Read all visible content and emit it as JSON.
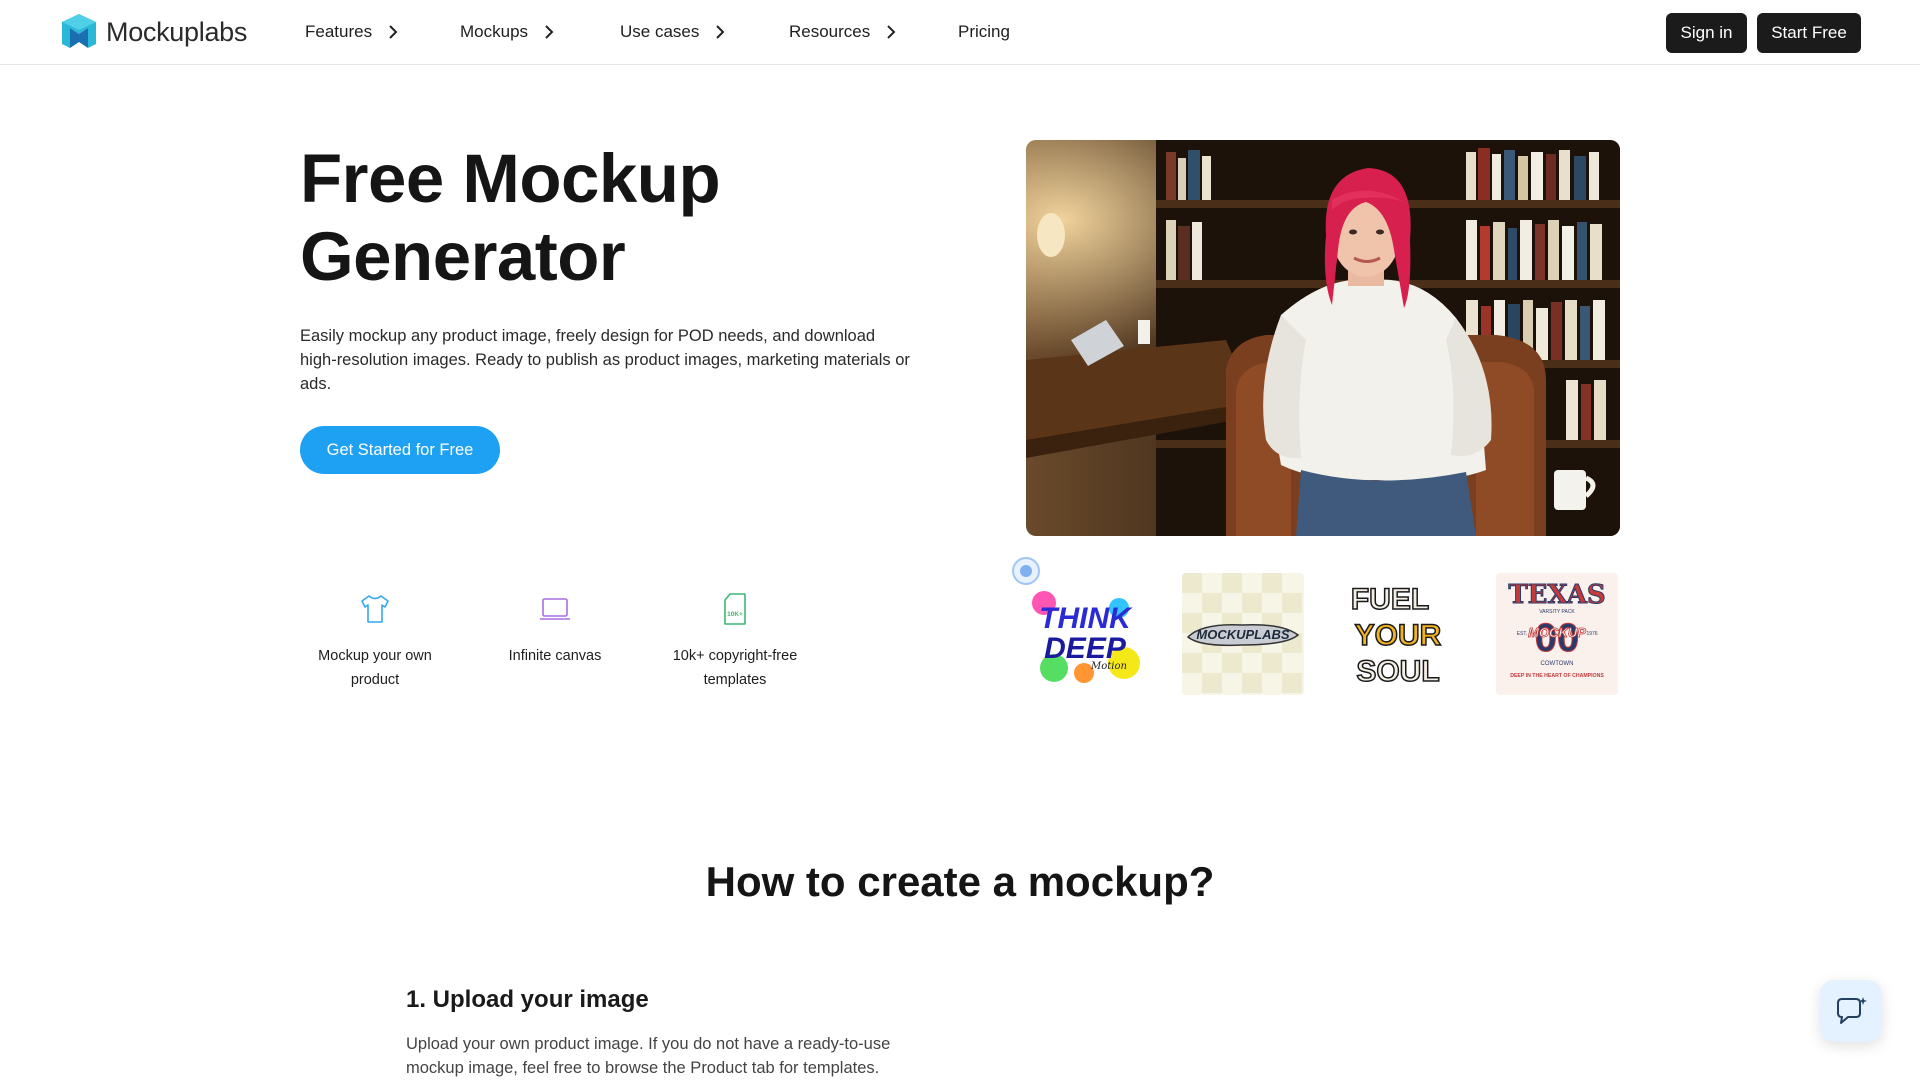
{
  "header": {
    "logo_text": "Mockuplabs",
    "nav": [
      {
        "label": "Features",
        "has_chevron": true
      },
      {
        "label": "Mockups",
        "has_chevron": true
      },
      {
        "label": "Use cases",
        "has_chevron": true
      },
      {
        "label": "Resources",
        "has_chevron": true
      },
      {
        "label": "Pricing",
        "has_chevron": false
      }
    ],
    "sign_in": "Sign in",
    "start_free": "Start Free"
  },
  "hero": {
    "title_line1": "Free Mockup",
    "title_line2": "Generator",
    "description": "Easily mockup any product image, freely design for POD needs, and download high-resolution images. Ready to publish as product images, marketing materials or ads.",
    "cta": "Get Started for Free",
    "features": [
      {
        "icon": "tshirt-icon",
        "label": "Mockup your own product"
      },
      {
        "icon": "laptop-icon",
        "label": "Infinite canvas"
      },
      {
        "icon": "template-file-icon",
        "label": "10k+ copyright-free templates",
        "icon_text": "10K+"
      }
    ],
    "photo": {
      "icon": "woman-in-white-sweatshirt-photo"
    },
    "designs": [
      {
        "icon": "think-deep-design",
        "text": [
          "THINK",
          "DEEP",
          "Motion"
        ]
      },
      {
        "icon": "mockuplabs-logo-design",
        "text": [
          "MOCKUPLABS"
        ]
      },
      {
        "icon": "fuel-your-soul-design",
        "text": [
          "FUEL",
          "YOUR",
          "SOUL"
        ]
      },
      {
        "icon": "texas-mockup-design",
        "text": [
          "TEXAS",
          "MOCKUP",
          "VARSITY PACK",
          "00",
          "EST.",
          "1976",
          "COWTOWN",
          "DEEP IN THE HEART OF CHAMPIONS"
        ]
      }
    ]
  },
  "how_to": {
    "title": "How to create a mockup?",
    "step1_title": "1. Upload your image",
    "step1_desc": "Upload your own product image. If you do not have a ready-to-use mockup image, feel free to browse the Product tab for templates."
  },
  "chat": {
    "icon": "chat-bubble-icon"
  },
  "colors": {
    "accent": "#1ea1f2",
    "dark": "#1b1b1b"
  }
}
